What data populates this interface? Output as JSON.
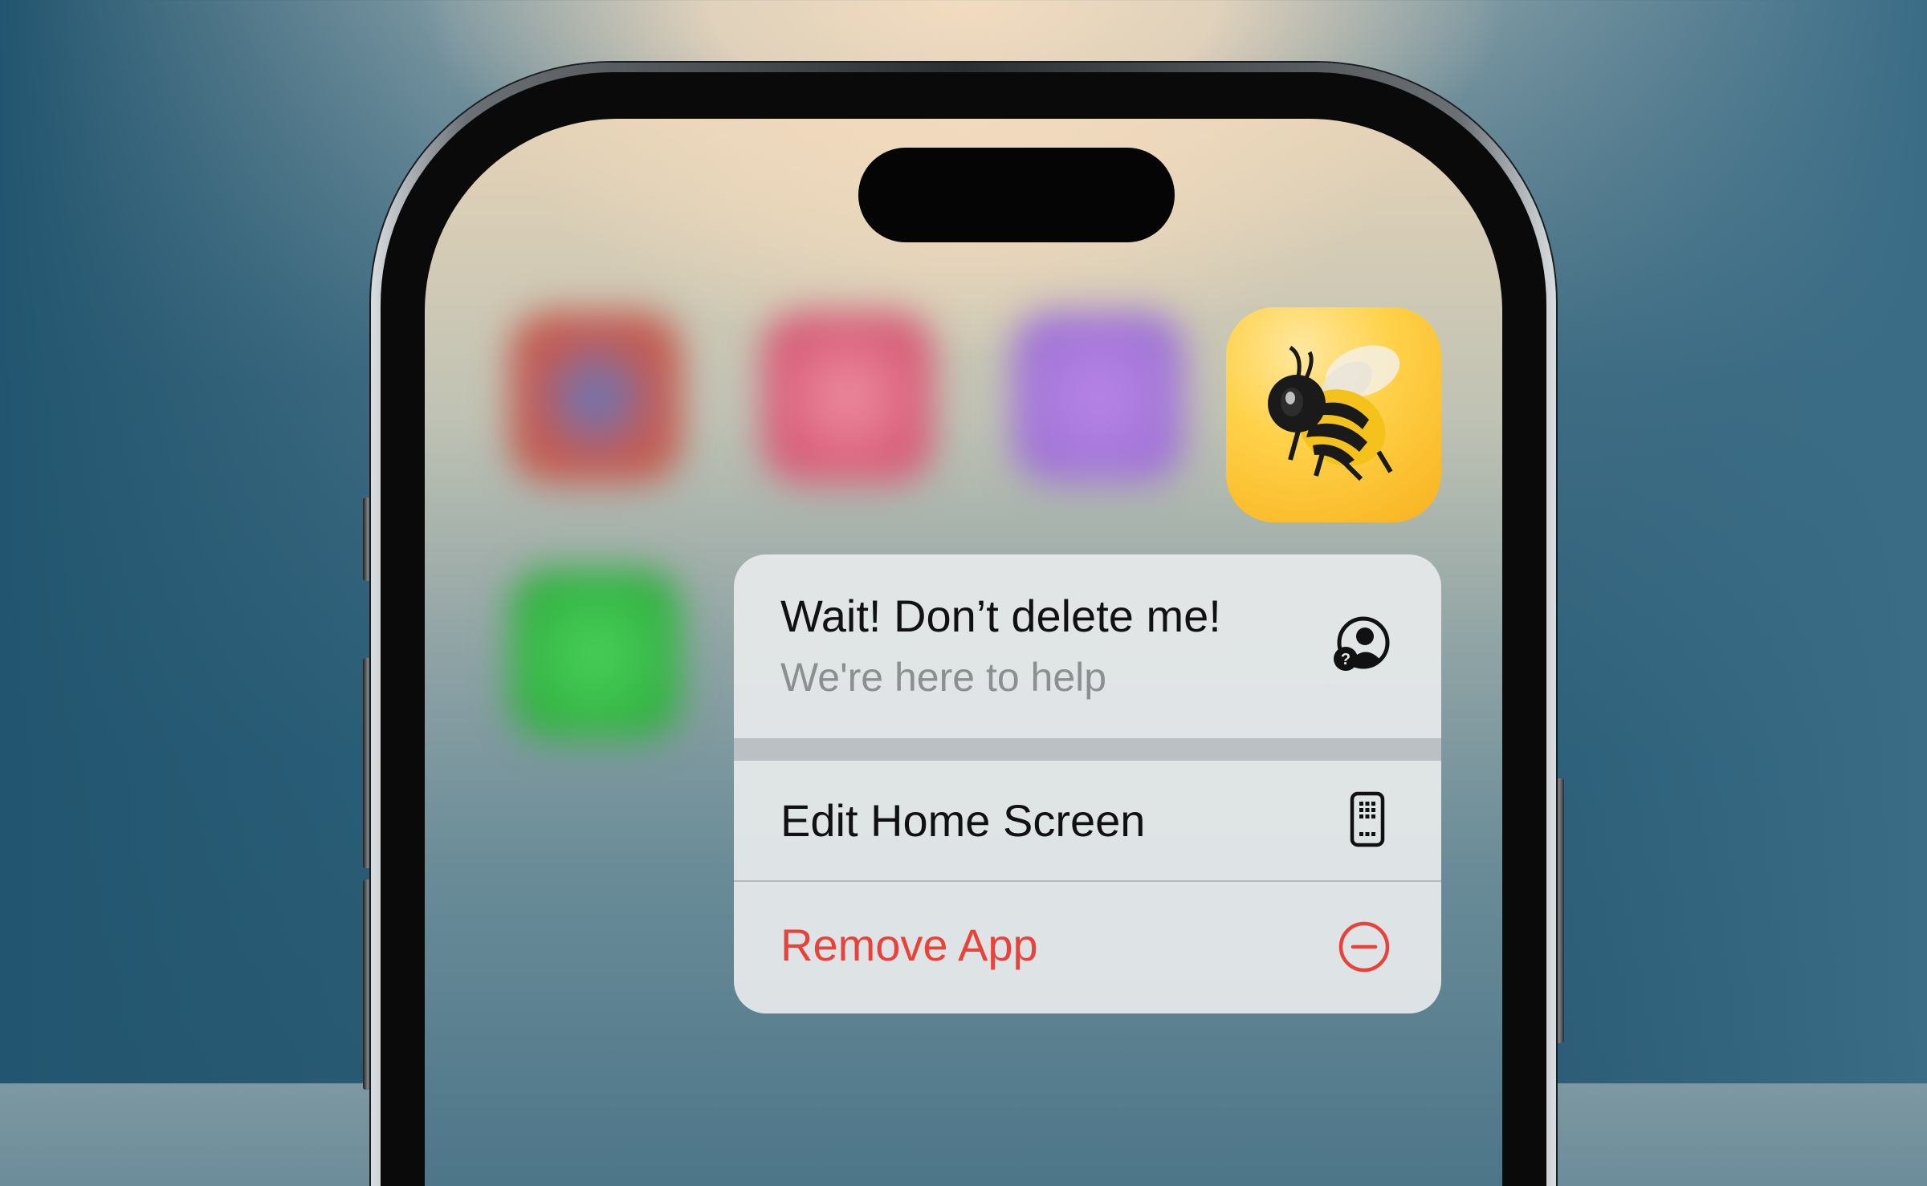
{
  "menu": {
    "help_title": "Wait! Don’t delete me!",
    "help_subtitle": "We're here to help",
    "help_icon": "person-question-icon",
    "edit_label": "Edit Home Screen",
    "edit_icon": "phone-apps-icon",
    "remove_label": "Remove App",
    "remove_icon": "minus-circle-icon"
  },
  "app_icon": "bee-app-icon",
  "colors": {
    "destructive": "#e8423a",
    "menu_text": "#111111",
    "menu_subtext": "#8c8f92"
  }
}
